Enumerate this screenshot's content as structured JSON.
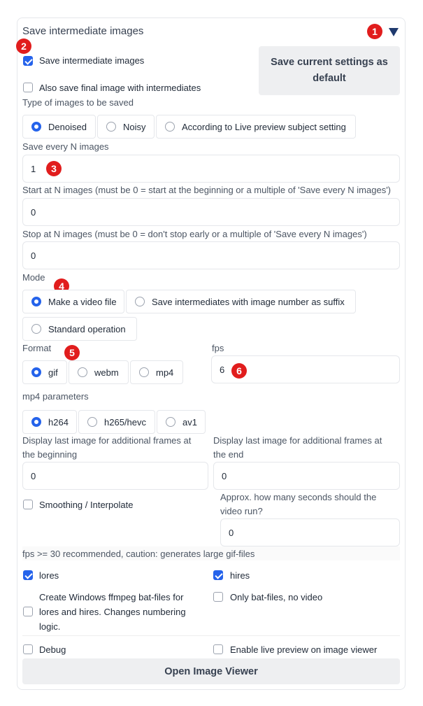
{
  "accordion": {
    "title": "Save intermediate images",
    "toggle_icon": "triangle-down-icon"
  },
  "badges": [
    "1",
    "2",
    "3",
    "4",
    "5",
    "6"
  ],
  "save_intermediate": {
    "label": "Save intermediate images",
    "checked": true
  },
  "also_save_final": {
    "label": "Also save final image with intermediates",
    "checked": false
  },
  "save_default_button": {
    "label": "Save current settings as default"
  },
  "image_type": {
    "label": "Type of images to be saved",
    "options": [
      "Denoised",
      "Noisy",
      "According to Live preview subject setting"
    ],
    "selected": "Denoised"
  },
  "save_every": {
    "label": "Save every N images",
    "value": "1"
  },
  "start_at": {
    "label": "Start at N images (must be 0 = start at the beginning or a multiple of 'Save every N images')",
    "value": "0"
  },
  "stop_at": {
    "label": "Stop at N images (must be 0 = don't stop early or a multiple of 'Save every N images')",
    "value": "0"
  },
  "mode": {
    "label": "Mode",
    "options": [
      "Make a video file",
      "Save intermediates with image number as suffix",
      "Standard operation"
    ],
    "selected": "Make a video file"
  },
  "format": {
    "label": "Format",
    "options": [
      "gif",
      "webm",
      "mp4"
    ],
    "selected": "gif"
  },
  "fps": {
    "label": "fps",
    "value": "6"
  },
  "mp4_params": {
    "label": "mp4 parameters",
    "options": [
      "h264",
      "h265/hevc",
      "av1"
    ],
    "selected": "h264"
  },
  "last_frames_begin": {
    "label": "Display last image for additional frames at the beginning",
    "value": "0"
  },
  "last_frames_end": {
    "label": "Display last image for additional frames at the end",
    "value": "0"
  },
  "smoothing": {
    "label": "Smoothing / Interpolate",
    "checked": false
  },
  "video_seconds": {
    "label": "Approx. how many seconds should the video run?",
    "value": "0"
  },
  "fps_note": "fps >= 30 recommended, caution: generates large gif-files",
  "lores": {
    "label": "lores",
    "checked": true
  },
  "hires": {
    "label": "hires",
    "checked": true
  },
  "bat_files": {
    "label": "Create Windows ffmpeg bat-files for lores and hires. Changes numbering logic.",
    "checked": false
  },
  "only_bat": {
    "label": "Only bat-files, no video",
    "checked": false
  },
  "debug": {
    "label": "Debug",
    "checked": false
  },
  "live_preview": {
    "label": "Enable live preview on image viewer",
    "checked": false
  },
  "open_viewer_button": {
    "label": "Open Image Viewer"
  },
  "colors": {
    "accent": "#2563eb",
    "badge": "#e11d1d"
  }
}
